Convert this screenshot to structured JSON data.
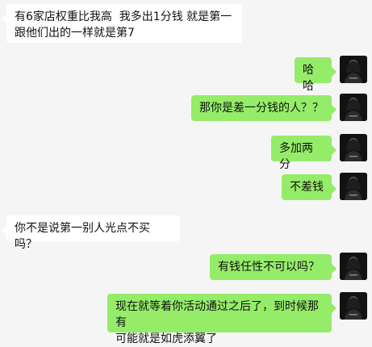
{
  "messages": [
    {
      "side": "in",
      "text": "有6家店权重比我高  我多出1分钱 就是第一\n跟他们出的一样就是第7"
    },
    {
      "side": "out",
      "text": "哈哈"
    },
    {
      "side": "out",
      "text": "那你是差一分钱的人？？"
    },
    {
      "side": "out",
      "text": "多加两分"
    },
    {
      "side": "out",
      "text": "不差钱"
    },
    {
      "side": "in",
      "text": "你不是说第一别人光点不买吗？"
    },
    {
      "side": "out",
      "text": "有钱任性不可以吗？"
    },
    {
      "side": "out",
      "text": "现在就等着你活动通过之后了，到时候那有\n可能就是如虎添翼了"
    }
  ],
  "colors": {
    "background": "#f5f5f5",
    "incoming_bubble": "#ffffff",
    "outgoing_bubble": "#95ec69"
  },
  "avatar": {
    "icon": "user-avatar-photo"
  }
}
